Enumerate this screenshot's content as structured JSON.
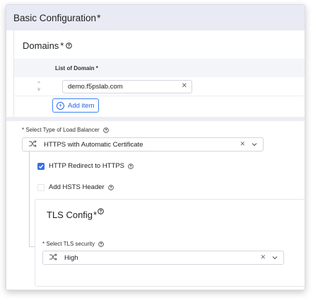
{
  "header": {
    "title": "Basic Configuration",
    "required_mark": "*"
  },
  "domains": {
    "title": "Domains",
    "required_mark": "*",
    "column_header": "List of Domain *",
    "items": [
      {
        "value": "demo.f5pslab.com"
      }
    ],
    "add_label": "Add item"
  },
  "load_balancer": {
    "label": "* Select Type of Load Balancer",
    "selected": "HTTPS with Automatic Certificate"
  },
  "options": {
    "http_redirect": {
      "label": "HTTP Redirect to HTTPS",
      "checked": true
    },
    "hsts": {
      "label": "Add HSTS Header",
      "checked": false
    }
  },
  "tls": {
    "title": "TLS Config",
    "required_mark": "*",
    "security_label": "* Select TLS security",
    "security_selected": "High"
  },
  "colors": {
    "accent": "#3b6fe0",
    "header_bg": "#e8eaf4",
    "link": "#2563eb"
  },
  "icons": {
    "help": "question-circle-icon",
    "select": "shuffle-icon",
    "clear": "close-icon",
    "dropdown": "chevron-down-icon",
    "sort": "sort-arrows-icon",
    "add": "plus-circle-icon",
    "check": "checkmark-icon"
  }
}
